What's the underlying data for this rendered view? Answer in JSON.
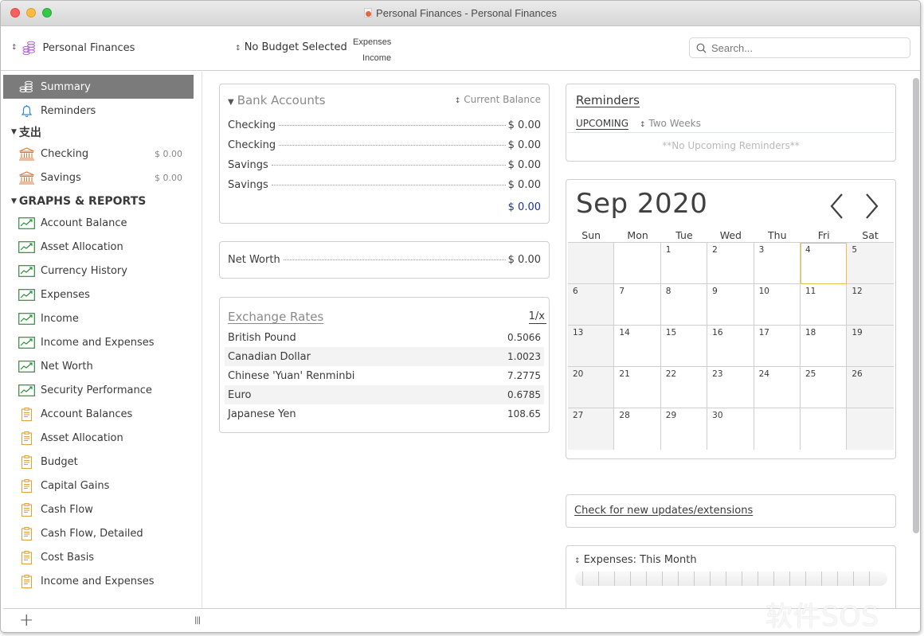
{
  "window": {
    "title": "Personal Finances - Personal Finances"
  },
  "toolbar": {
    "file_name": "Personal Finances",
    "budget": "No Budget Selected",
    "expenses_label": "Expenses",
    "income_label": "Income",
    "search_placeholder": "Search..."
  },
  "sidebar": {
    "top_items": [
      {
        "label": "Summary",
        "icon": "coins-icon",
        "selected": true
      },
      {
        "label": "Reminders",
        "icon": "bell-icon",
        "selected": false
      }
    ],
    "accounts_section": {
      "label": "支出",
      "items": [
        {
          "label": "Checking",
          "amount": "$ 0.00",
          "icon": "bank-icon"
        },
        {
          "label": "Savings",
          "amount": "$ 0.00",
          "icon": "bank-icon"
        }
      ]
    },
    "reports_section": {
      "label": "GRAPHS & REPORTS",
      "graphs": [
        {
          "label": "Account Balance",
          "icon": "graph-icon"
        },
        {
          "label": "Asset Allocation",
          "icon": "graph-icon"
        },
        {
          "label": "Currency History",
          "icon": "graph-icon"
        },
        {
          "label": "Expenses",
          "icon": "graph-icon"
        },
        {
          "label": "Income",
          "icon": "graph-icon"
        },
        {
          "label": "Income and Expenses",
          "icon": "graph-icon"
        },
        {
          "label": "Net Worth",
          "icon": "graph-icon"
        },
        {
          "label": "Security Performance",
          "icon": "graph-icon"
        }
      ],
      "reports": [
        {
          "label": "Account Balances",
          "icon": "report-icon"
        },
        {
          "label": "Asset Allocation",
          "icon": "report-icon"
        },
        {
          "label": "Budget",
          "icon": "report-icon"
        },
        {
          "label": "Capital Gains",
          "icon": "report-icon"
        },
        {
          "label": "Cash Flow",
          "icon": "report-icon"
        },
        {
          "label": "Cash Flow, Detailed",
          "icon": "report-icon"
        },
        {
          "label": "Cost Basis",
          "icon": "report-icon"
        },
        {
          "label": "Income and Expenses",
          "icon": "report-icon"
        }
      ]
    },
    "add_label": "+",
    "resize_label": "|||"
  },
  "bank_accounts": {
    "title": "Bank Accounts",
    "sort_label": "Current Balance",
    "rows": [
      {
        "name": "Checking",
        "value": "$ 0.00"
      },
      {
        "name": "Checking",
        "value": "$ 0.00"
      },
      {
        "name": "Savings",
        "value": "$ 0.00"
      },
      {
        "name": "Savings",
        "value": "$ 0.00"
      }
    ],
    "total": "$ 0.00"
  },
  "net_worth": {
    "label": "Net Worth",
    "value": "$ 0.00"
  },
  "exchange_rates": {
    "title": "Exchange Rates",
    "toggle": "1/x",
    "rows": [
      {
        "currency": "British Pound",
        "rate": "0.5066"
      },
      {
        "currency": "Canadian Dollar",
        "rate": "1.0023"
      },
      {
        "currency": "Chinese 'Yuan' Renminbi",
        "rate": "7.2775"
      },
      {
        "currency": "Euro",
        "rate": "0.6785"
      },
      {
        "currency": "Japanese Yen",
        "rate": "108.65"
      }
    ]
  },
  "reminders": {
    "title": "Reminders",
    "tab": "UPCOMING",
    "period": "Two Weeks",
    "empty_text": "**No Upcoming Reminders**"
  },
  "calendar": {
    "title": "Sep 2020",
    "weekdays": [
      "Sun",
      "Mon",
      "Tue",
      "Wed",
      "Thu",
      "Fri",
      "Sat"
    ],
    "today": 4,
    "weeks": [
      [
        "",
        "",
        "1",
        "2",
        "3",
        "4",
        "5"
      ],
      [
        "6",
        "7",
        "8",
        "9",
        "10",
        "11",
        "12"
      ],
      [
        "13",
        "14",
        "15",
        "16",
        "17",
        "18",
        "19"
      ],
      [
        "20",
        "21",
        "22",
        "23",
        "24",
        "25",
        "26"
      ],
      [
        "27",
        "28",
        "29",
        "30",
        "",
        "",
        ""
      ]
    ]
  },
  "updates": {
    "link": "Check for new updates/extensions"
  },
  "expenses_widget": {
    "title": "Expenses: This Month"
  },
  "colors": {
    "selected_bg": "#7b7b7b",
    "total_blue": "#1a2fa0",
    "graph_green": "#2e8b3a",
    "report_orange": "#e0a040",
    "bank_orange": "#d8793a",
    "bell_blue": "#2f86e0",
    "coins_purple": "#b36ad6",
    "today_outline": "#e8c24a"
  },
  "watermark": "软件SOS"
}
